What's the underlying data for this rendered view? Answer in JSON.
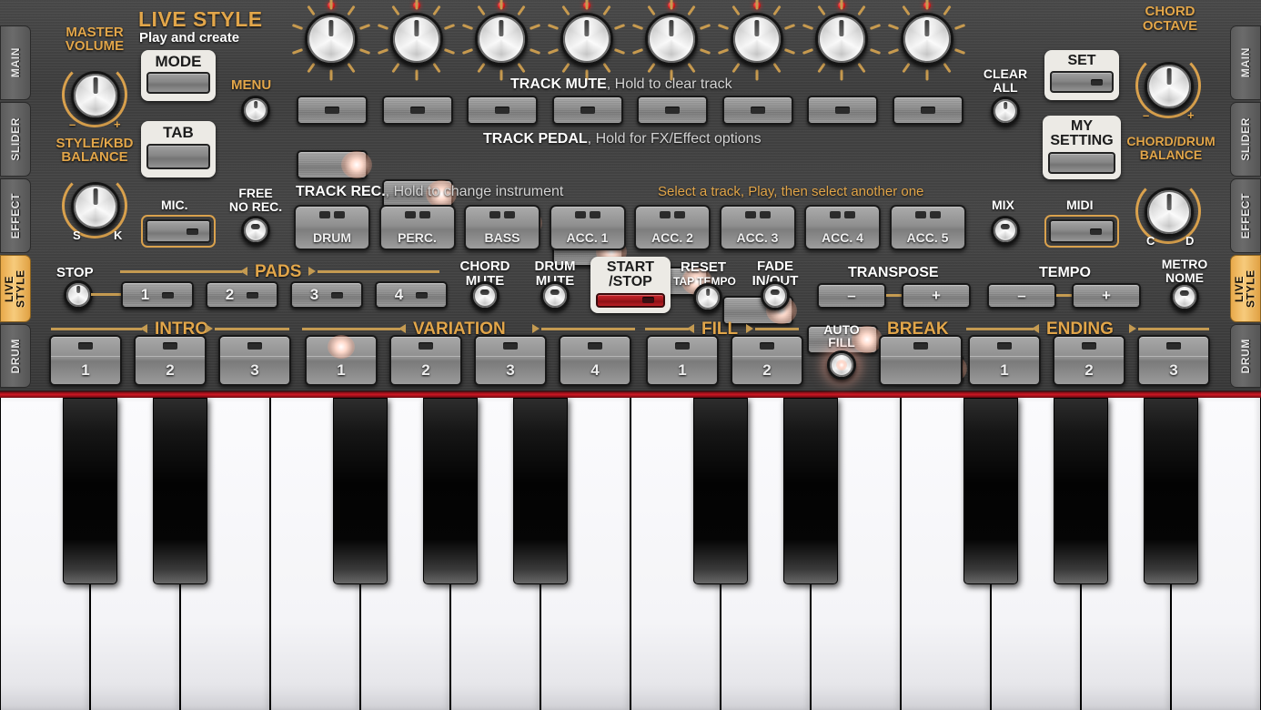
{
  "colors": {
    "accent": "#e2a64a",
    "panel": "#444444",
    "red_strip": "#d01824",
    "tab_active_bg": "#f0bb63",
    "led": "#e02020"
  },
  "side_tabs": [
    {
      "label": "MAIN",
      "active": false
    },
    {
      "label": "SLIDER",
      "active": false
    },
    {
      "label": "EFFECT",
      "active": false
    },
    {
      "label": "LIVE STYLE",
      "active": true
    },
    {
      "label": "DRUM",
      "active": false
    }
  ],
  "header": {
    "title": "LIVE STYLE",
    "subtitle": "Play and create"
  },
  "left_controls": {
    "master_volume_label": "MASTER\nVOLUME",
    "master_volume_minus": "–",
    "master_volume_plus": "+",
    "style_kbd_label": "STYLE/KBD\nBALANCE",
    "style_kbd_s": "S",
    "style_kbd_k": "K",
    "mode_button": "MODE",
    "tab_button": "TAB",
    "menu_label": "MENU",
    "mic_label": "MIC.",
    "free_no_rec_label": "FREE\nNO REC."
  },
  "right_controls": {
    "clear_all_label": "CLEAR\nALL",
    "set_button": "SET",
    "my_setting_button": "MY\nSETTING",
    "chord_octave_label": "CHORD\nOCTAVE",
    "chord_octave_minus": "–",
    "chord_octave_plus": "+",
    "chord_drum_label": "CHORD/DRUM\nBALANCE",
    "chord_drum_c": "C",
    "chord_drum_d": "D",
    "mix_label": "MIX",
    "midi_label": "MIDI"
  },
  "track_section": {
    "mute_header_bold": "TRACK MUTE",
    "mute_header_rest": ", Hold to clear track",
    "pedal_header_bold": "TRACK  PEDAL",
    "pedal_header_rest": ", Hold for FX/Effect options",
    "rec_header_bold": "TRACK  REC.",
    "rec_header_rest": ", Hold to change instrument",
    "hint": "Select a track, Play, then select another one",
    "tracks": [
      "DRUM",
      "PERC.",
      "BASS",
      "ACC. 1",
      "ACC. 2",
      "ACC. 3",
      "ACC. 4",
      "ACC. 5"
    ],
    "mixer_knob_count": 8
  },
  "transport": {
    "stop_label": "STOP",
    "pads_label": "PADS",
    "pads": [
      "1",
      "2",
      "3",
      "4"
    ],
    "chord_mute_label": "CHORD\nMUTE",
    "drum_mute_label": "DRUM\nMUTE",
    "start_stop_label": "START\n/STOP",
    "reset_label": "RESET",
    "tap_tempo_label": "TAP TEMPO",
    "fade_label": "FADE\nIN/OUT",
    "transpose_label": "TRANSPOSE",
    "transpose_minus": "–",
    "transpose_plus": "+",
    "tempo_label": "TEMPO",
    "tempo_minus": "–",
    "tempo_plus": "+",
    "metronome_label": "METRO\nNOME"
  },
  "style_row": {
    "intro_label": "INTRO",
    "intro_buttons": [
      "1",
      "2",
      "3"
    ],
    "variation_label": "VARIATION",
    "variation_buttons": [
      "1",
      "2",
      "3",
      "4"
    ],
    "variation_active_index": 0,
    "fill_label": "FILL",
    "fill_buttons": [
      "1",
      "2"
    ],
    "auto_fill_label": "AUTO\nFILL",
    "break_label": "BREAK",
    "ending_label": "ENDING",
    "ending_buttons": [
      "1",
      "2",
      "3"
    ]
  },
  "keyboard": {
    "white_key_count": 14,
    "black_key_pattern": [
      1,
      1,
      0,
      1,
      1,
      1,
      0,
      1,
      1,
      0,
      1,
      1,
      1,
      0
    ]
  }
}
